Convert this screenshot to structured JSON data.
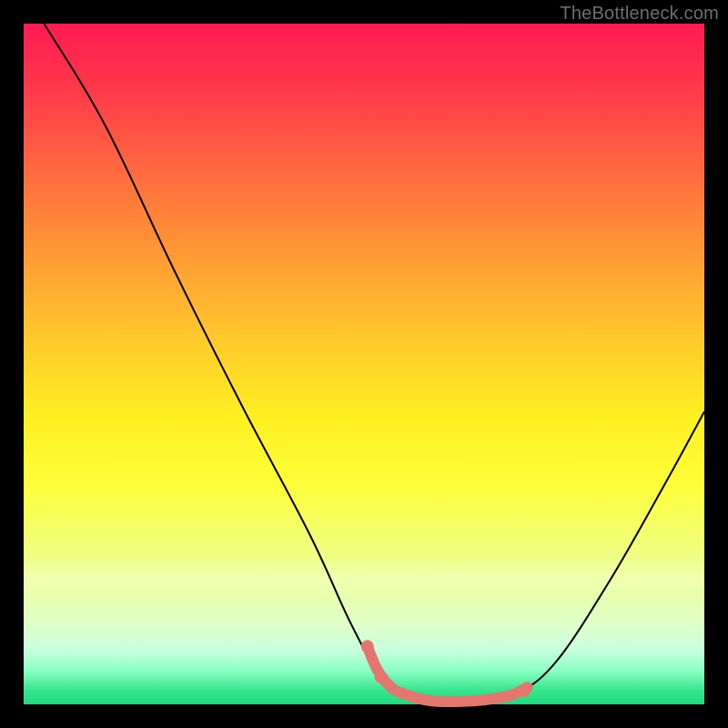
{
  "watermark": "TheBottleneck.com",
  "chart_data": {
    "type": "line",
    "title": "",
    "xlabel": "",
    "ylabel": "",
    "xlim": [
      0,
      100
    ],
    "ylim": [
      0,
      100
    ],
    "series": [
      {
        "name": "curve",
        "stroke": "#000000",
        "stroke_width": 2,
        "points": [
          {
            "x": 3.0,
            "y": 100.0
          },
          {
            "x": 12.0,
            "y": 85.0
          },
          {
            "x": 22.0,
            "y": 64.0
          },
          {
            "x": 32.0,
            "y": 44.0
          },
          {
            "x": 42.0,
            "y": 25.0
          },
          {
            "x": 48.0,
            "y": 12.0
          },
          {
            "x": 52.0,
            "y": 5.0
          },
          {
            "x": 56.0,
            "y": 1.5
          },
          {
            "x": 60.0,
            "y": 0.5
          },
          {
            "x": 66.0,
            "y": 0.5
          },
          {
            "x": 72.0,
            "y": 1.5
          },
          {
            "x": 78.0,
            "y": 6.0
          },
          {
            "x": 86.0,
            "y": 18.0
          },
          {
            "x": 94.0,
            "y": 32.0
          },
          {
            "x": 100.0,
            "y": 43.0
          }
        ]
      },
      {
        "name": "highlight",
        "stroke": "#e3776f",
        "stroke_width": 12,
        "linecap": "round",
        "points": [
          {
            "x": 50.5,
            "y": 8.5
          },
          {
            "x": 52.0,
            "y": 5.0
          },
          {
            "x": 54.0,
            "y": 2.5
          },
          {
            "x": 56.0,
            "y": 1.5
          },
          {
            "x": 60.0,
            "y": 0.5
          },
          {
            "x": 66.0,
            "y": 0.5
          },
          {
            "x": 70.0,
            "y": 1.0
          },
          {
            "x": 72.0,
            "y": 1.5
          },
          {
            "x": 74.0,
            "y": 2.5
          }
        ]
      }
    ],
    "markers": [
      {
        "x": 50.5,
        "y": 8.5,
        "r": 7,
        "fill": "#e3776f"
      },
      {
        "x": 52.5,
        "y": 4.0,
        "r": 7,
        "fill": "#e3776f"
      },
      {
        "x": 73.5,
        "y": 2.0,
        "r": 7,
        "fill": "#e3776f"
      }
    ]
  }
}
